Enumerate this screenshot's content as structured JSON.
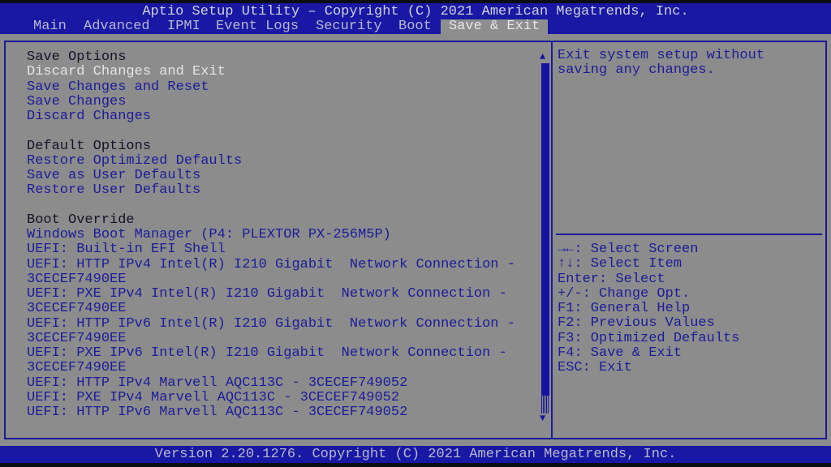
{
  "header": {
    "title": "Aptio Setup Utility – Copyright (C) 2021 American Megatrends, Inc.",
    "tabs": [
      "Main",
      "Advanced",
      "IPMI",
      "Event Logs",
      "Security",
      "Boot",
      "Save & Exit"
    ],
    "selected_tab": "Save & Exit"
  },
  "menu": {
    "save_options": "Save Options",
    "items1": [
      "Discard Changes and Exit",
      "Save Changes and Reset",
      "Save Changes",
      "Discard Changes"
    ],
    "default_options": "Default Options",
    "items2": [
      "Restore Optimized Defaults",
      "Save as User Defaults",
      "Restore User Defaults"
    ],
    "boot_override": "Boot Override",
    "items3": [
      "Windows Boot Manager (P4: PLEXTOR PX-256M5P)",
      "UEFI: Built-in EFI Shell",
      "UEFI: HTTP IPv4 Intel(R) I210 Gigabit  Network Connection -",
      "3CECEF7490EE",
      "UEFI: PXE IPv4 Intel(R) I210 Gigabit  Network Connection -",
      "3CECEF7490EE",
      "UEFI: HTTP IPv6 Intel(R) I210 Gigabit  Network Connection -",
      "3CECEF7490EE",
      "UEFI: PXE IPv6 Intel(R) I210 Gigabit  Network Connection -",
      "3CECEF7490EE",
      "UEFI: HTTP IPv4 Marvell AQC113C - 3CECEF749052",
      "UEFI: PXE IPv4 Marvell AQC113C - 3CECEF749052",
      "UEFI: HTTP IPv6 Marvell AQC113C - 3CECEF749052"
    ],
    "selected": "Discard Changes and Exit"
  },
  "help": {
    "description": "Exit system setup without\nsaving any changes.",
    "keys": [
      "→←: Select Screen",
      "↑↓: Select Item",
      "Enter: Select",
      "+/-: Change Opt.",
      "F1: General Help",
      "F2: Previous Values",
      "F3: Optimized Defaults",
      "F4: Save & Exit",
      "ESC: Exit"
    ]
  },
  "footer": "Version 2.20.1276. Copyright (C) 2021 American Megatrends, Inc.",
  "colors": {
    "header_bg": "#1818a4",
    "panel_bg": "#8c8c8c",
    "text": "#1c1c9a"
  }
}
